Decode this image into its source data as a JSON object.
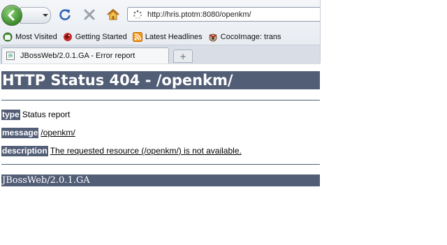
{
  "browser": {
    "url": "http://hris.ptotm:8080/openkm/",
    "bookmarks": [
      {
        "label": "Most Visited",
        "icon": "most-visited-icon"
      },
      {
        "label": "Getting Started",
        "icon": "getting-started-icon"
      },
      {
        "label": "Latest Headlines",
        "icon": "rss-icon"
      },
      {
        "label": "CocoImage: trans",
        "icon": "cocoimage-icon"
      }
    ],
    "tab_title": "JBossWeb/2.0.1.GA - Error report",
    "new_tab_symbol": "+"
  },
  "page": {
    "heading": "HTTP Status 404 - /openkm/",
    "type_label": "type",
    "type_value": "Status report",
    "message_label": "message",
    "message_value": "/openkm/",
    "description_label": "description",
    "description_value": "The requested resource (/openkm/) is not available.",
    "footer": "JBossWeb/2.0.1.GA"
  },
  "colors": {
    "header_bg": "#525d76",
    "back_button": "#3c8a2c"
  }
}
